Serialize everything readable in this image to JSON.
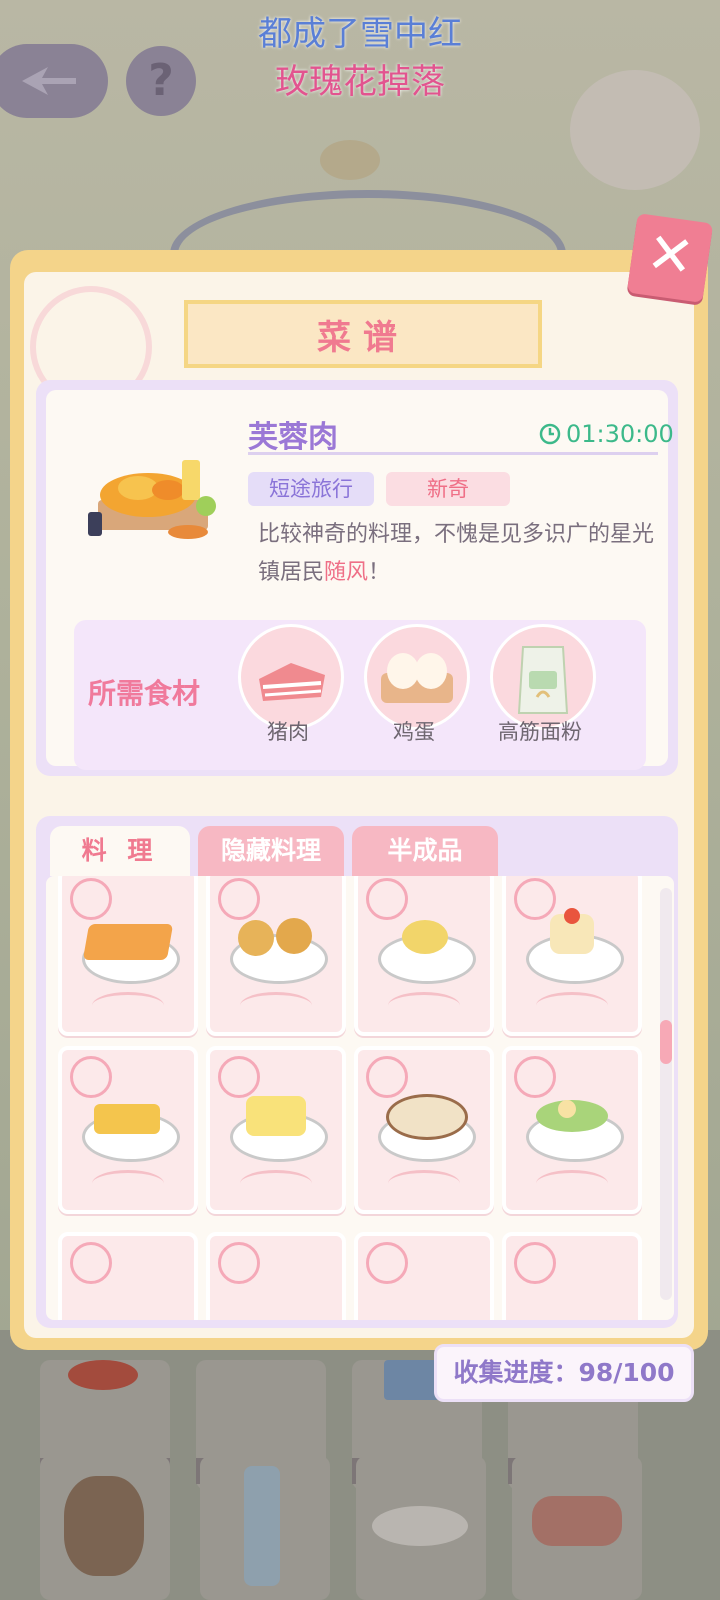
{
  "lyrics": {
    "line1": "都成了雪中红",
    "line2": "玫瑰花掉落"
  },
  "topbar": {
    "help_label": "?"
  },
  "panel": {
    "title": "菜谱",
    "close_label": "✕",
    "dish": {
      "name": "芙蓉肉",
      "time": "01:30:00",
      "tags": [
        "短途旅行",
        "新奇"
      ],
      "description_prefix": "比较神奇的料理，不愧是见多识广的星光镇居民",
      "description_highlight": "随风",
      "description_suffix": "！"
    },
    "ingredients": {
      "label": "所需食材",
      "items": [
        {
          "name": "猪肉",
          "icon": "pork-icon"
        },
        {
          "name": "鸡蛋",
          "icon": "egg-carton-icon"
        },
        {
          "name": "高筋面粉",
          "icon": "flour-bag-icon"
        }
      ]
    },
    "tabs": [
      "料 理",
      "隐藏料理",
      "半成品"
    ],
    "progress": "收集进度：98/100"
  },
  "background_items": [
    "草莓",
    "鸡蛋",
    "牛奶",
    "花生"
  ],
  "colors": {
    "accent": "#f07a90",
    "purple": "#9b78d6",
    "timer": "#3cb98a"
  }
}
